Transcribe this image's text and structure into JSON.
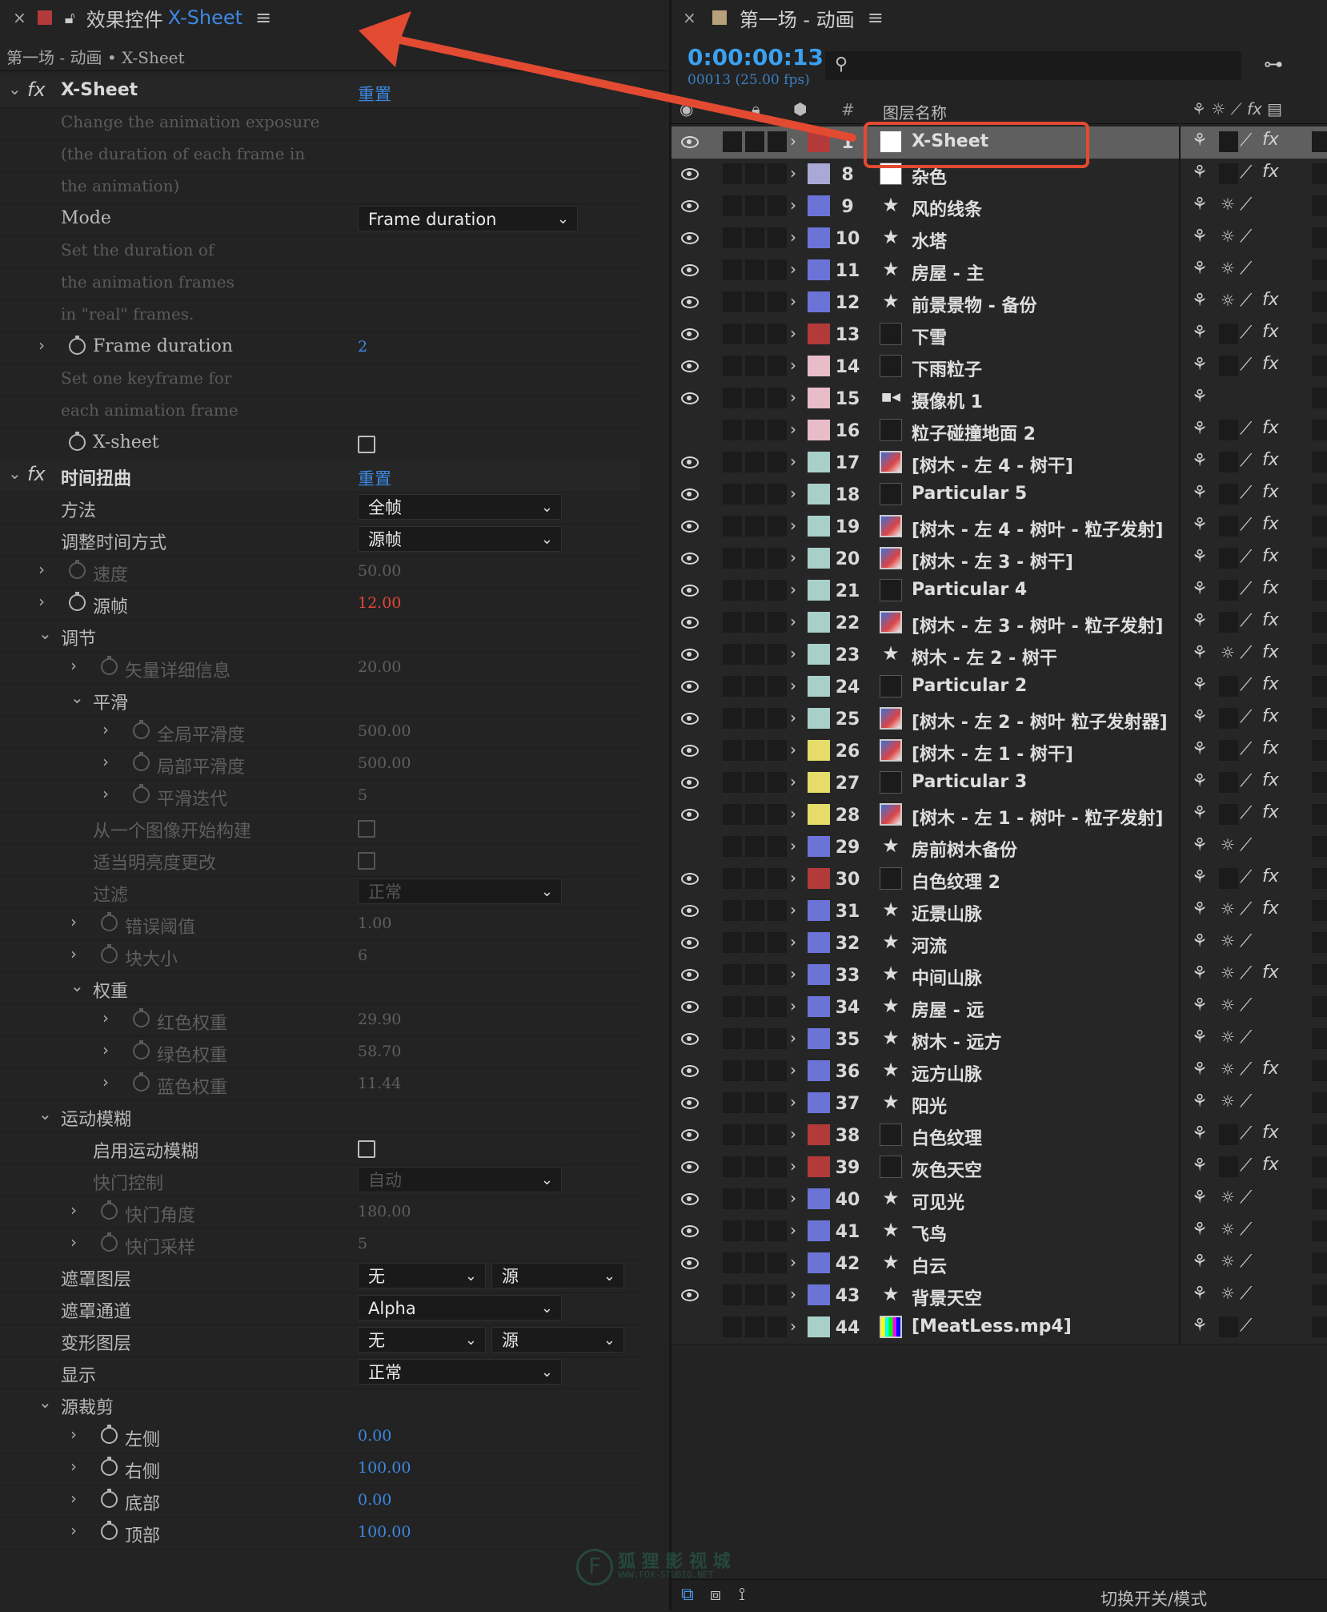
{
  "left_panel": {
    "tab_title_prefix": "效果控件",
    "tab_title_layer": "X-Sheet",
    "breadcrumb": "第一场 - 动画 • X-Sheet",
    "rows": [
      {
        "kind": "fx",
        "label": "X-Sheet",
        "value": "重置"
      },
      {
        "kind": "hint",
        "label": "Change the animation exposure"
      },
      {
        "kind": "hint",
        "label": "(the duration of each frame in"
      },
      {
        "kind": "hint",
        "label": "the animation)"
      },
      {
        "kind": "dropdown",
        "label": "Mode",
        "value": "Frame duration",
        "serif": true
      },
      {
        "kind": "hint",
        "label": "Set the duration of"
      },
      {
        "kind": "hint",
        "label": "the animation frames"
      },
      {
        "kind": "hint",
        "label": "in \"real\" frames."
      },
      {
        "kind": "prop",
        "label": "Frame duration",
        "value": "2",
        "stopwatch": true,
        "twirl": true,
        "valstyle": "blue",
        "serif": true
      },
      {
        "kind": "hint",
        "label": "Set one keyframe for"
      },
      {
        "kind": "hint",
        "label": "each animation frame"
      },
      {
        "kind": "checkbox",
        "label": "X-sheet",
        "stopwatch": true,
        "serif": true
      },
      {
        "kind": "fx",
        "label": "时间扭曲",
        "value": "重置"
      },
      {
        "kind": "dropdown",
        "label": "方法",
        "value": "全帧"
      },
      {
        "kind": "dropdown",
        "label": "调整时间方式",
        "value": "源帧"
      },
      {
        "kind": "prop",
        "label": "速度",
        "value": "50.00",
        "stopwatch": true,
        "twirl": true,
        "dim": true
      },
      {
        "kind": "prop",
        "label": "源帧",
        "value": "12.00",
        "stopwatch": true,
        "twirl": true,
        "valstyle": "red"
      },
      {
        "kind": "group",
        "label": "调节",
        "indent": 1
      },
      {
        "kind": "prop",
        "label": "矢量详细信息",
        "value": "20.00",
        "stopwatch": true,
        "twirl": true,
        "dim": true,
        "indent": 2
      },
      {
        "kind": "group",
        "label": "平滑",
        "indent": 2
      },
      {
        "kind": "prop",
        "label": "全局平滑度",
        "value": "500.00",
        "stopwatch": true,
        "twirl": true,
        "dim": true,
        "indent": 3
      },
      {
        "kind": "prop",
        "label": "局部平滑度",
        "value": "500.00",
        "stopwatch": true,
        "twirl": true,
        "dim": true,
        "indent": 3
      },
      {
        "kind": "prop",
        "label": "平滑迭代",
        "value": "5",
        "stopwatch": true,
        "twirl": true,
        "dim": true,
        "indent": 3
      },
      {
        "kind": "checkbox",
        "label": "从一个图像开始构建",
        "dim": true,
        "indent": 2
      },
      {
        "kind": "checkbox",
        "label": "适当明亮度更改",
        "dim": true,
        "indent": 2
      },
      {
        "kind": "dropdown",
        "label": "过滤",
        "value": "正常",
        "dim": true,
        "indent": 2
      },
      {
        "kind": "prop",
        "label": "错误阈值",
        "value": "1.00",
        "stopwatch": true,
        "twirl": true,
        "dim": true,
        "indent": 2
      },
      {
        "kind": "prop",
        "label": "块大小",
        "value": "6",
        "stopwatch": true,
        "twirl": true,
        "dim": true,
        "indent": 2
      },
      {
        "kind": "group",
        "label": "权重",
        "indent": 2
      },
      {
        "kind": "prop",
        "label": "红色权重",
        "value": "29.90",
        "stopwatch": true,
        "twirl": true,
        "dim": true,
        "indent": 3
      },
      {
        "kind": "prop",
        "label": "绿色权重",
        "value": "58.70",
        "stopwatch": true,
        "twirl": true,
        "dim": true,
        "indent": 3
      },
      {
        "kind": "prop",
        "label": "蓝色权重",
        "value": "11.44",
        "stopwatch": true,
        "twirl": true,
        "dim": true,
        "indent": 3
      },
      {
        "kind": "group",
        "label": "运动模糊",
        "indent": 1
      },
      {
        "kind": "checkbox",
        "label": "启用运动模糊",
        "indent": 2
      },
      {
        "kind": "dropdown",
        "label": "快门控制",
        "value": "自动",
        "dim": true,
        "indent": 2
      },
      {
        "kind": "prop",
        "label": "快门角度",
        "value": "180.00",
        "stopwatch": true,
        "twirl": true,
        "dim": true,
        "indent": 2
      },
      {
        "kind": "prop",
        "label": "快门采样",
        "value": "5",
        "stopwatch": true,
        "twirl": true,
        "dim": true,
        "indent": 2
      },
      {
        "kind": "dropdown2",
        "label": "遮罩图层",
        "value": "无",
        "value2": "源"
      },
      {
        "kind": "dropdown",
        "label": "遮罩通道",
        "value": "Alpha"
      },
      {
        "kind": "dropdown2",
        "label": "变形图层",
        "value": "无",
        "value2": "源"
      },
      {
        "kind": "dropdown",
        "label": "显示",
        "value": "正常"
      },
      {
        "kind": "group",
        "label": "源裁剪",
        "indent": 1
      },
      {
        "kind": "prop",
        "label": "左侧",
        "value": "0.00",
        "stopwatch": true,
        "twirl": true,
        "valstyle": "blue",
        "indent": 2
      },
      {
        "kind": "prop",
        "label": "右侧",
        "value": "100.00",
        "stopwatch": true,
        "twirl": true,
        "valstyle": "blue",
        "indent": 2
      },
      {
        "kind": "prop",
        "label": "底部",
        "value": "0.00",
        "stopwatch": true,
        "twirl": true,
        "valstyle": "blue",
        "indent": 2
      },
      {
        "kind": "prop",
        "label": "顶部",
        "value": "100.00",
        "stopwatch": true,
        "twirl": true,
        "valstyle": "blue",
        "indent": 2
      }
    ]
  },
  "right_panel": {
    "tab_title": "第一场 - 动画",
    "timecode": "0:00:00:13",
    "frame_info": "00013 (25.00 fps)",
    "search_placeholder": "",
    "col_num": "#",
    "col_name": "图层名称",
    "bottom_label": "切换开关/模式",
    "layers": [
      {
        "num": "1",
        "name": "X-Sheet",
        "color": "#b23a3a",
        "src": "solid-w",
        "eye": true,
        "fx": true,
        "sun": false,
        "sel": true
      },
      {
        "num": "8",
        "name": "杂色",
        "color": "#a9a8d6",
        "src": "solid-w",
        "eye": true,
        "fx": true,
        "sun": false
      },
      {
        "num": "9",
        "name": "风的线条",
        "color": "#6b74d6",
        "src": "star",
        "eye": true,
        "fx": false,
        "sun": true
      },
      {
        "num": "10",
        "name": "水塔",
        "color": "#6b74d6",
        "src": "star",
        "eye": true,
        "fx": false,
        "sun": true
      },
      {
        "num": "11",
        "name": "房屋 - 主",
        "color": "#6b74d6",
        "src": "star",
        "eye": true,
        "fx": false,
        "sun": true
      },
      {
        "num": "12",
        "name": "前景景物 - 备份",
        "color": "#6b74d6",
        "src": "star",
        "eye": true,
        "fx": true,
        "sun": true
      },
      {
        "num": "13",
        "name": "下雪",
        "color": "#b23a3a",
        "src": "solid-d",
        "eye": true,
        "fx": true,
        "sun": false
      },
      {
        "num": "14",
        "name": "下雨粒子",
        "color": "#e8bcc8",
        "src": "solid-d",
        "eye": true,
        "fx": true,
        "sun": false
      },
      {
        "num": "15",
        "name": "摄像机 1",
        "color": "#e8bcc8",
        "src": "cam",
        "eye": true,
        "fx": false,
        "sun": false,
        "noswitch": true
      },
      {
        "num": "16",
        "name": "粒子碰撞地面 2",
        "color": "#e8bcc8",
        "src": "solid-d",
        "eye": false,
        "fx": true,
        "sun": false
      },
      {
        "num": "17",
        "name": "[树木 - 左 4 - 树干]",
        "color": "#a8d0c8",
        "src": "img",
        "eye": true,
        "fx": true,
        "sun": false
      },
      {
        "num": "18",
        "name": "Particular 5",
        "color": "#a8d0c8",
        "src": "solid-d",
        "eye": true,
        "fx": true,
        "sun": false
      },
      {
        "num": "19",
        "name": "[树木 - 左 4 - 树叶 - 粒子发射]",
        "color": "#a8d0c8",
        "src": "img",
        "eye": true,
        "fx": true,
        "sun": false
      },
      {
        "num": "20",
        "name": "[树木 - 左 3 - 树干]",
        "color": "#a8d0c8",
        "src": "img",
        "eye": true,
        "fx": true,
        "sun": false
      },
      {
        "num": "21",
        "name": "Particular 4",
        "color": "#a8d0c8",
        "src": "solid-d",
        "eye": true,
        "fx": true,
        "sun": false
      },
      {
        "num": "22",
        "name": "[树木 - 左 3 - 树叶 - 粒子发射]",
        "color": "#a8d0c8",
        "src": "img",
        "eye": true,
        "fx": true,
        "sun": false
      },
      {
        "num": "23",
        "name": "树木 - 左 2 - 树干",
        "color": "#a8d0c8",
        "src": "star",
        "eye": true,
        "fx": true,
        "sun": true
      },
      {
        "num": "24",
        "name": "Particular 2",
        "color": "#a8d0c8",
        "src": "solid-d",
        "eye": true,
        "fx": true,
        "sun": false
      },
      {
        "num": "25",
        "name": "[树木 - 左 2 - 树叶 粒子发射器]",
        "color": "#a8d0c8",
        "src": "img",
        "eye": true,
        "fx": true,
        "sun": false
      },
      {
        "num": "26",
        "name": "[树木 - 左 1 - 树干]",
        "color": "#e6dc6a",
        "src": "img",
        "eye": true,
        "fx": true,
        "sun": false
      },
      {
        "num": "27",
        "name": "Particular 3",
        "color": "#e6dc6a",
        "src": "solid-d",
        "eye": true,
        "fx": true,
        "sun": false
      },
      {
        "num": "28",
        "name": "[树木 - 左 1 - 树叶 - 粒子发射]",
        "color": "#e6dc6a",
        "src": "img",
        "eye": true,
        "fx": true,
        "sun": false
      },
      {
        "num": "29",
        "name": "房前树木备份",
        "color": "#6b74d6",
        "src": "star",
        "eye": false,
        "fx": false,
        "sun": true
      },
      {
        "num": "30",
        "name": "白色纹理 2",
        "color": "#b23a3a",
        "src": "solid-d",
        "eye": true,
        "fx": true,
        "sun": false
      },
      {
        "num": "31",
        "name": "近景山脉",
        "color": "#6b74d6",
        "src": "star",
        "eye": true,
        "fx": true,
        "sun": true
      },
      {
        "num": "32",
        "name": "河流",
        "color": "#6b74d6",
        "src": "star",
        "eye": true,
        "fx": false,
        "sun": true
      },
      {
        "num": "33",
        "name": "中间山脉",
        "color": "#6b74d6",
        "src": "star",
        "eye": true,
        "fx": true,
        "sun": true
      },
      {
        "num": "34",
        "name": "房屋 - 远",
        "color": "#6b74d6",
        "src": "star",
        "eye": true,
        "fx": false,
        "sun": true
      },
      {
        "num": "35",
        "name": "树木 - 远方",
        "color": "#6b74d6",
        "src": "star",
        "eye": true,
        "fx": false,
        "sun": true
      },
      {
        "num": "36",
        "name": "远方山脉",
        "color": "#6b74d6",
        "src": "star",
        "eye": true,
        "fx": true,
        "sun": true
      },
      {
        "num": "37",
        "name": "阳光",
        "color": "#6b74d6",
        "src": "star",
        "eye": true,
        "fx": false,
        "sun": true
      },
      {
        "num": "38",
        "name": "白色纹理",
        "color": "#b23a3a",
        "src": "solid-d",
        "eye": true,
        "fx": true,
        "sun": false
      },
      {
        "num": "39",
        "name": "灰色天空",
        "color": "#b23a3a",
        "src": "solid-d",
        "eye": true,
        "fx": true,
        "sun": false
      },
      {
        "num": "40",
        "name": "可见光",
        "color": "#6b74d6",
        "src": "star",
        "eye": true,
        "fx": false,
        "sun": true
      },
      {
        "num": "41",
        "name": "飞鸟",
        "color": "#6b74d6",
        "src": "star",
        "eye": true,
        "fx": false,
        "sun": true
      },
      {
        "num": "42",
        "name": "白云",
        "color": "#6b74d6",
        "src": "star",
        "eye": true,
        "fx": false,
        "sun": true
      },
      {
        "num": "43",
        "name": "背景天空",
        "color": "#6b74d6",
        "src": "star",
        "eye": true,
        "fx": false,
        "sun": true
      },
      {
        "num": "44",
        "name": "[MeatLess.mp4]",
        "color": "#a8d0c8",
        "src": "vid",
        "eye": false,
        "fx": false,
        "sun": false
      }
    ]
  },
  "watermark": {
    "line1": "狐 狸 影 视 城",
    "line2": "WWW.FOX-STUDIO.NET"
  },
  "colors": {
    "accent_blue": "#3d88e4",
    "highlight_red": "#e0473a",
    "arrow_red": "#e24a32"
  }
}
